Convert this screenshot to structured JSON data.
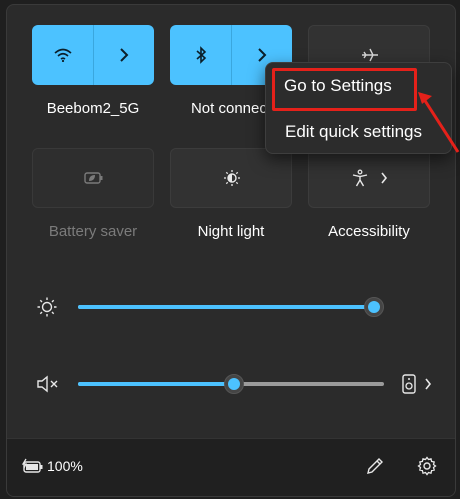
{
  "tiles": {
    "wifi": {
      "label": "Beebom2_5G",
      "icon": "wifi-icon",
      "chevron": "chevron-right-icon"
    },
    "bluetooth": {
      "label": "Not connect",
      "icon": "bluetooth-icon",
      "chevron": "chevron-right-icon"
    },
    "airplane": {
      "label": "",
      "icon": "airplane-icon"
    },
    "battery_saver": {
      "label": "Battery saver",
      "icon": "battery-saver-icon"
    },
    "night_light": {
      "label": "Night light",
      "icon": "night-light-icon"
    },
    "accessibility": {
      "label": "Accessibility",
      "icon": "accessibility-icon",
      "chevron": "chevron-right-icon"
    }
  },
  "sliders": {
    "brightness": {
      "icon": "brightness-icon",
      "value": 1.0
    },
    "volume": {
      "icon": "speaker-muted-icon",
      "value": 0.51,
      "output_icon": "speaker-output-icon"
    }
  },
  "footer": {
    "battery_text": "100%",
    "battery_icon": "battery-charging-icon",
    "edit_icon": "pencil-icon",
    "settings_icon": "gear-icon"
  },
  "context_menu": {
    "items": [
      {
        "label": "Go to Settings"
      },
      {
        "label": "Edit quick settings"
      }
    ]
  },
  "colors": {
    "accent": "#4cc2ff",
    "highlight": "#e5211a",
    "panel": "#2b2b2b"
  }
}
